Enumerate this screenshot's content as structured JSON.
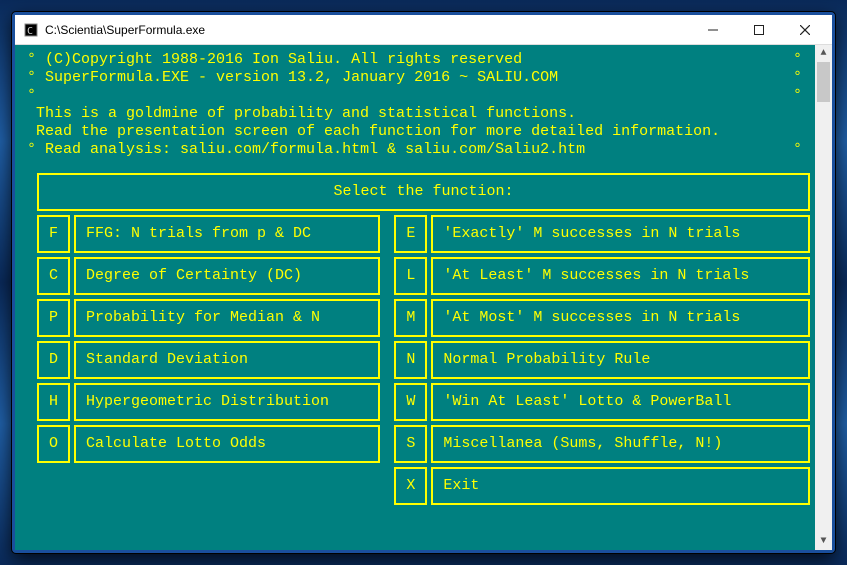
{
  "window": {
    "title": "C:\\Scientia\\SuperFormula.exe"
  },
  "header": {
    "line1_l": "°",
    "line1": " (C)Copyright 1988-2016 Ion Saliu. All rights reserved",
    "line1_r": "°",
    "line2_l": "°",
    "line2": " SuperFormula.EXE - version 13.2, January 2016 ~ SALIU.COM",
    "line2_r": "°",
    "line3_l": "°",
    "line3_r": "°",
    "intro1": " This is a goldmine of probability and statistical functions.",
    "intro2": " Read the presentation screen of each function for more detailed information.",
    "intro3_l": "°",
    "intro3": " Read analysis: saliu.com/formula.html & saliu.com/Saliu2.htm",
    "intro3_r": "°"
  },
  "menu": {
    "title": "Select the function:",
    "left": [
      {
        "key": "F",
        "label": "FFG: N trials from p & DC"
      },
      {
        "key": "C",
        "label": "Degree of Certainty (DC)"
      },
      {
        "key": "P",
        "label": "Probability for Median & N"
      },
      {
        "key": "D",
        "label": "Standard Deviation"
      },
      {
        "key": "H",
        "label": "Hypergeometric Distribution"
      },
      {
        "key": "O",
        "label": "Calculate Lotto Odds"
      }
    ],
    "right": [
      {
        "key": "E",
        "label": "'Exactly' M successes in N trials"
      },
      {
        "key": "L",
        "label": "'At Least' M successes in N trials"
      },
      {
        "key": "M",
        "label": "'At Most' M successes in N trials"
      },
      {
        "key": "N",
        "label": "Normal Probability Rule"
      },
      {
        "key": "W",
        "label": "'Win At Least' Lotto & PowerBall"
      },
      {
        "key": "S",
        "label": "Miscellanea (Sums, Shuffle, N!)"
      }
    ],
    "exit": {
      "key": "X",
      "label": "Exit"
    }
  }
}
